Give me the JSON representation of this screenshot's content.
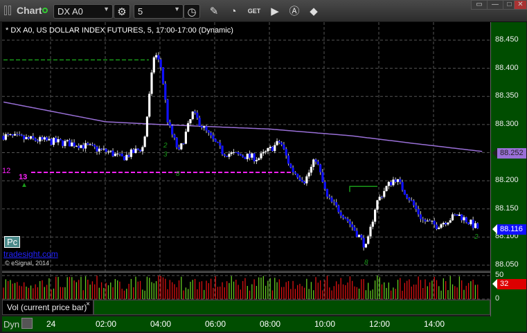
{
  "toolbar": {
    "title": "Chart",
    "symbol": "DX A0",
    "interval": "5"
  },
  "chart": {
    "info": "* DX A0, US DOLLAR INDEX FUTURES, 5, 17:00-17:00 (Dynamic)",
    "price_ticks": [
      "88.450",
      "88.400",
      "88.350",
      "88.300",
      "88.250",
      "88.200",
      "88.150",
      "88.100",
      "88.050"
    ],
    "ma_value": "88.252",
    "last_price": "88.116",
    "pc_label": "Pc",
    "link": "tradesight.com",
    "copyright": "© eSignal, 2014",
    "markers": {
      "m12": "12",
      "m13": "13"
    }
  },
  "chart_data": {
    "type": "candlestick",
    "ylim": [
      88.05,
      88.45
    ],
    "path": [
      [
        -1.72,
        88.28
      ],
      [
        -1,
        88.275
      ],
      [
        0,
        88.27
      ],
      [
        1,
        88.265
      ],
      [
        2.2,
        88.25
      ],
      [
        2.6,
        88.24
      ],
      [
        3.4,
        88.26
      ],
      [
        3.8,
        88.43
      ],
      [
        4.05,
        88.4
      ],
      [
        4.3,
        88.3
      ],
      [
        4.7,
        88.25
      ],
      [
        5.2,
        88.32
      ],
      [
        5.8,
        88.28
      ],
      [
        6.3,
        88.25
      ],
      [
        7.6,
        88.24
      ],
      [
        8.4,
        88.27
      ],
      [
        8.8,
        88.22
      ],
      [
        9.3,
        88.2
      ],
      [
        9.7,
        88.24
      ],
      [
        10.1,
        88.17
      ],
      [
        10.7,
        88.14
      ],
      [
        11.3,
        88.1
      ],
      [
        11.55,
        88.08
      ],
      [
        11.9,
        88.16
      ],
      [
        12.3,
        88.19
      ],
      [
        12.6,
        88.205
      ],
      [
        13.1,
        88.17
      ],
      [
        13.6,
        88.13
      ],
      [
        14.1,
        88.12
      ],
      [
        14.9,
        88.14
      ],
      [
        15.6,
        88.116
      ]
    ],
    "ma": [
      [
        -1.72,
        88.34
      ],
      [
        2,
        88.305
      ],
      [
        4,
        88.3
      ],
      [
        8,
        88.292
      ],
      [
        11,
        88.28
      ],
      [
        13,
        88.268
      ],
      [
        15.8,
        88.252
      ]
    ]
  },
  "volume": {
    "ticks": [
      "50",
      "0"
    ],
    "last": "32",
    "legend": "Vol (current price bar)",
    "close": "×"
  },
  "time_axis": {
    "mode": "Dyn",
    "labels": [
      "24",
      "02:00",
      "04:00",
      "06:00",
      "08:00",
      "10:00",
      "12:00",
      "14:00"
    ]
  },
  "colors": {
    "up": "#ffffff",
    "down": "#1010ff",
    "ma": "#9a70d8",
    "magenta": "#ff22ff",
    "green": "#1a9a1a"
  }
}
